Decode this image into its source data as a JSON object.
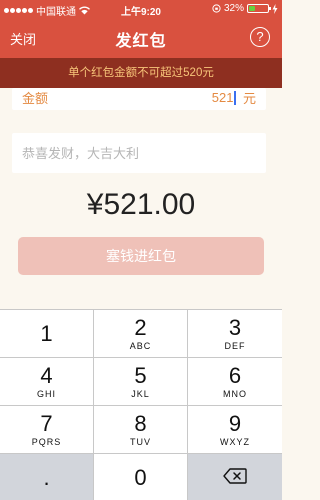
{
  "status_bar": {
    "carrier": "中国联通",
    "time": "上午9:20",
    "battery": "32%",
    "battery_level": 0.32
  },
  "nav": {
    "close_label": "关闭",
    "title": "发红包",
    "help_label": "?"
  },
  "warning": "单个红包金额不可超过520元",
  "amount": {
    "label": "金额",
    "value": "521",
    "unit": "元"
  },
  "greeting": {
    "placeholder": "恭喜发财，大吉大利",
    "value": ""
  },
  "total": "¥521.00",
  "submit_label": "塞钱进红包",
  "keypad": {
    "keys": [
      {
        "num": "1",
        "letters": ""
      },
      {
        "num": "2",
        "letters": "ABC"
      },
      {
        "num": "3",
        "letters": "DEF"
      },
      {
        "num": "4",
        "letters": "GHI"
      },
      {
        "num": "5",
        "letters": "JKL"
      },
      {
        "num": "6",
        "letters": "MNO"
      },
      {
        "num": "7",
        "letters": "PQRS"
      },
      {
        "num": "8",
        "letters": "TUV"
      },
      {
        "num": "9",
        "letters": "WXYZ"
      },
      {
        "num": ".",
        "letters": ""
      },
      {
        "num": "0",
        "letters": ""
      },
      {
        "num": "",
        "letters": "",
        "icon": "backspace-icon"
      }
    ]
  }
}
